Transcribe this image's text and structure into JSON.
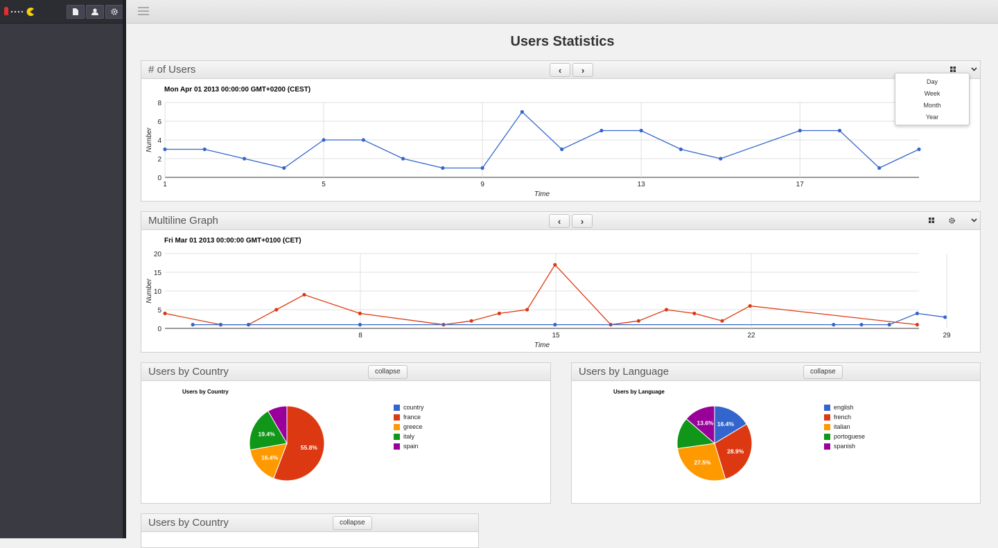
{
  "page": {
    "title": "Users Statistics"
  },
  "sidebar": {
    "buttons": [
      "document-icon",
      "user-icon",
      "gear-icon"
    ]
  },
  "panels": {
    "users": {
      "title": "# of Users",
      "date": "Mon Apr 01 2013 00:00:00 GMT+0200 (CEST)",
      "dropdown": [
        "Day",
        "Week",
        "Month",
        "Year"
      ]
    },
    "multiline": {
      "title": "Multiline Graph",
      "date": "Fri Mar 01 2013 00:00:00 GMT+0100 (CET)"
    },
    "country": {
      "title": "Users by Country",
      "collapse": "collapse",
      "caption": "Users by Country"
    },
    "language": {
      "title": "Users by Language",
      "collapse": "collapse",
      "caption": "Users by Language"
    },
    "country2": {
      "title": "Users by Country",
      "collapse": "collapse"
    }
  },
  "colors": {
    "blue": "#3366cc",
    "red": "#dc3912",
    "orange": "#ff9900",
    "green": "#109618",
    "purple": "#990099"
  },
  "chart_data": [
    {
      "type": "line",
      "xlabel": "Time",
      "ylabel": "Number",
      "xlim": [
        1,
        20
      ],
      "ylim": [
        0,
        8
      ],
      "xticks": [
        1,
        5,
        9,
        13,
        17
      ],
      "yticks": [
        0,
        2,
        4,
        6,
        8
      ],
      "grid": true,
      "series": [
        {
          "x": [
            1,
            2,
            3,
            4,
            5,
            6,
            7,
            8,
            9,
            10,
            11,
            12,
            13,
            14,
            15,
            17,
            18,
            19,
            20
          ],
          "values": [
            3,
            3,
            2,
            1,
            4,
            4,
            2,
            1,
            1,
            7,
            3,
            5,
            5,
            3,
            2,
            5,
            5,
            1,
            3
          ],
          "color": "#3366cc"
        }
      ]
    },
    {
      "type": "line",
      "xlabel": "Time",
      "ylabel": "Number",
      "xlim": [
        1,
        31
      ],
      "ylim": [
        0,
        20
      ],
      "xticks": [
        8,
        15,
        22,
        29
      ],
      "yticks": [
        0,
        5,
        10,
        15,
        20
      ],
      "grid": true,
      "series": [
        {
          "x": [
            1,
            3,
            4,
            5,
            6,
            7,
            9,
            12,
            13,
            14,
            15,
            16,
            18,
            19,
            20,
            21,
            22,
            24,
            31
          ],
          "values": [
            4,
            1,
            1,
            5,
            9,
            4,
            1,
            2,
            4,
            5,
            17,
            1,
            2,
            5,
            4,
            2,
            6,
            1,
            1
          ],
          "color": "#dc3912",
          "x_days": [
            1,
            3,
            4,
            6,
            7,
            9,
            13,
            14,
            15,
            16,
            17,
            19,
            20,
            21,
            22,
            23,
            24,
            31
          ]
        },
        {
          "x": [
            2,
            3,
            4,
            8,
            15,
            27,
            28,
            29,
            30,
            31
          ],
          "values": [
            1,
            1,
            1,
            1,
            1,
            1,
            1,
            1,
            4,
            3
          ],
          "color": "#3366cc"
        }
      ]
    },
    {
      "type": "pie",
      "title": "Users by Country",
      "categories": [
        "country",
        "france",
        "greece",
        "italy",
        "spain"
      ],
      "values": [
        0,
        55.8,
        16.4,
        19.4,
        8.4
      ],
      "labels": [
        "",
        "55.8%",
        "16.4%",
        "19.4%",
        ""
      ],
      "colors": [
        "#3366cc",
        "#dc3912",
        "#ff9900",
        "#109618",
        "#990099"
      ],
      "legend": "right"
    },
    {
      "type": "pie",
      "title": "Users by Language",
      "categories": [
        "english",
        "french",
        "italian",
        "portoguese",
        "spanish"
      ],
      "values": [
        16.4,
        28.9,
        27.5,
        13.6,
        13.6
      ],
      "labels": [
        "16.4%",
        "28.9%",
        "27.5%",
        "",
        "13.6%"
      ],
      "colors": [
        "#3366cc",
        "#dc3912",
        "#ff9900",
        "#109618",
        "#990099"
      ],
      "legend": "right"
    }
  ]
}
